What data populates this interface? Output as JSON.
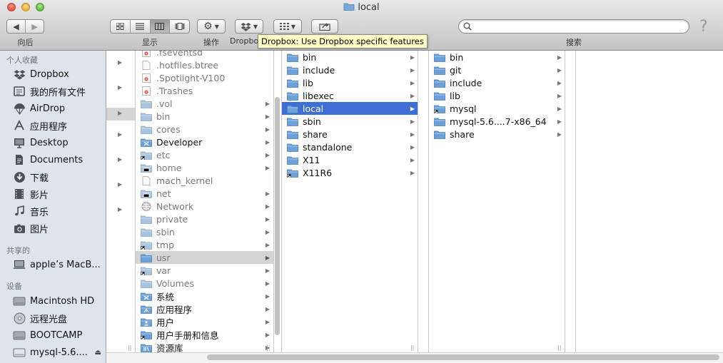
{
  "window": {
    "title": "local"
  },
  "toolbar": {
    "back_label": "向后",
    "view_label": "显示",
    "action_label": "操作",
    "dropbox_label": "Dropbox",
    "search_label": "搜索",
    "search_value": "",
    "help_glyph": "?"
  },
  "tooltip": {
    "text": "Dropbox: Use Dropbox specific features"
  },
  "sidebar": {
    "favorites_header": "个人收藏",
    "favorites": [
      {
        "label": "Dropbox",
        "icon": "dropbox-icon"
      },
      {
        "label": "我的所有文件",
        "icon": "all-files-icon"
      },
      {
        "label": "AirDrop",
        "icon": "airdrop-icon"
      },
      {
        "label": "应用程序",
        "icon": "applications-icon"
      },
      {
        "label": "Desktop",
        "icon": "desktop-icon"
      },
      {
        "label": "Documents",
        "icon": "documents-icon"
      },
      {
        "label": "下载",
        "icon": "downloads-icon"
      },
      {
        "label": "影片",
        "icon": "movies-icon"
      },
      {
        "label": "音乐",
        "icon": "music-icon"
      },
      {
        "label": "图片",
        "icon": "pictures-icon"
      }
    ],
    "shared_header": "共享的",
    "shared": [
      {
        "label": "apple’s MacB...",
        "icon": "computer-icon"
      }
    ],
    "devices_header": "设备",
    "devices": [
      {
        "label": "Macintosh HD",
        "icon": "hard-drive-icon"
      },
      {
        "label": "远程光盘",
        "icon": "optical-disc-icon"
      },
      {
        "label": "BOOTCAMP",
        "icon": "hard-drive-icon"
      },
      {
        "label": "mysql-5.6....",
        "icon": "disk-image-icon",
        "eject": "⏏"
      }
    ]
  },
  "columns": {
    "col1": [
      {
        "label": ".fseventsd",
        "dim": true,
        "type": "folder-red"
      },
      {
        "label": ".hotfiles.btree",
        "dim": true,
        "type": "file"
      },
      {
        "label": ".Spotlight-V100",
        "dim": true,
        "type": "folder-red"
      },
      {
        "label": ".Trashes",
        "dim": true,
        "type": "folder-red"
      },
      {
        "label": ".vol",
        "dim": true,
        "type": "folder",
        "arrow": true
      },
      {
        "label": "bin",
        "dim": true,
        "type": "folder",
        "arrow": true
      },
      {
        "label": "cores",
        "dim": true,
        "type": "folder",
        "arrow": true
      },
      {
        "label": "Developer",
        "dim": false,
        "type": "folder-dev",
        "arrow": true
      },
      {
        "label": "etc",
        "dim": true,
        "type": "alias",
        "arrow": true
      },
      {
        "label": "home",
        "dim": true,
        "type": "folder-net",
        "arrow": true
      },
      {
        "label": "mach_kernel",
        "dim": true,
        "type": "file"
      },
      {
        "label": "net",
        "dim": true,
        "type": "folder-net",
        "arrow": true
      },
      {
        "label": "Network",
        "dim": true,
        "type": "network",
        "arrow": true
      },
      {
        "label": "private",
        "dim": true,
        "type": "folder",
        "arrow": true
      },
      {
        "label": "sbin",
        "dim": true,
        "type": "folder",
        "arrow": true
      },
      {
        "label": "tmp",
        "dim": true,
        "type": "alias",
        "arrow": true
      },
      {
        "label": "usr",
        "dim": true,
        "type": "folder",
        "arrow": true,
        "selected": "gray"
      },
      {
        "label": "var",
        "dim": true,
        "type": "alias",
        "arrow": true
      },
      {
        "label": "Volumes",
        "dim": true,
        "type": "folder",
        "arrow": true
      },
      {
        "label": "系统",
        "dim": false,
        "type": "folder-sys",
        "arrow": true
      },
      {
        "label": "应用程序",
        "dim": false,
        "type": "folder-app",
        "arrow": true
      },
      {
        "label": "用户",
        "dim": false,
        "type": "folder-user",
        "arrow": true
      },
      {
        "label": "用户手册和信息",
        "dim": false,
        "type": "alias",
        "arrow": true
      },
      {
        "label": "资源库",
        "dim": false,
        "type": "folder-lib",
        "arrow": true
      }
    ],
    "col2": [
      {
        "label": "bin",
        "type": "folder",
        "arrow": true
      },
      {
        "label": "include",
        "type": "folder",
        "arrow": true
      },
      {
        "label": "lib",
        "type": "folder",
        "arrow": true
      },
      {
        "label": "libexec",
        "type": "folder",
        "arrow": true
      },
      {
        "label": "local",
        "type": "folder",
        "arrow": true,
        "selected": "blue"
      },
      {
        "label": "sbin",
        "type": "folder",
        "arrow": true
      },
      {
        "label": "share",
        "type": "folder",
        "arrow": true
      },
      {
        "label": "standalone",
        "type": "folder",
        "arrow": true
      },
      {
        "label": "X11",
        "type": "folder",
        "arrow": true
      },
      {
        "label": "X11R6",
        "type": "alias",
        "arrow": true
      }
    ],
    "col3": [
      {
        "label": "bin",
        "type": "folder",
        "arrow": true
      },
      {
        "label": "git",
        "type": "folder",
        "arrow": true
      },
      {
        "label": "include",
        "type": "folder",
        "arrow": true
      },
      {
        "label": "lib",
        "type": "folder",
        "arrow": true
      },
      {
        "label": "mysql",
        "type": "alias",
        "arrow": true
      },
      {
        "label": "mysql-5.6....7-x86_64",
        "type": "folder",
        "arrow": true
      },
      {
        "label": "share",
        "type": "folder",
        "arrow": true
      }
    ]
  },
  "colors": {
    "selection_blue": "#3d6fd6",
    "sidebar_bg": "#dde4ec",
    "folder_blue": "#6ca0d8"
  }
}
